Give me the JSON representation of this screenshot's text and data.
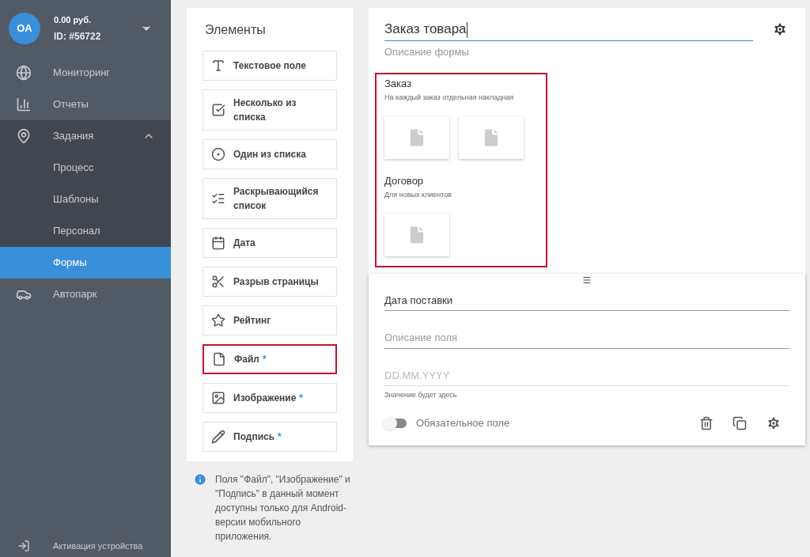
{
  "account": {
    "initials": "OA",
    "balance": "0.00 руб.",
    "id": "ID: #56722"
  },
  "nav": [
    {
      "kind": "globe",
      "label": "Мониторинг",
      "selected": false
    },
    {
      "kind": "chart",
      "label": "Отчеты",
      "selected": false
    },
    {
      "kind": "pin",
      "label": "Задания",
      "selected": false,
      "expanded": true,
      "children": [
        {
          "label": "Процесс",
          "selected": false
        },
        {
          "label": "Шаблоны",
          "selected": false
        },
        {
          "label": "Персонал",
          "selected": false
        },
        {
          "label": "Формы",
          "selected": true
        }
      ]
    },
    {
      "kind": "car",
      "label": "Автопарк",
      "selected": false
    }
  ],
  "activation": {
    "label": "Активация устройства"
  },
  "elements": {
    "title": "Элементы",
    "items": [
      {
        "kind": "text",
        "label": "Текстовое поле",
        "highlighted": false
      },
      {
        "kind": "checkbox",
        "label": "Несколько из списка",
        "highlighted": false
      },
      {
        "kind": "radio",
        "label": "Один из списка",
        "highlighted": false
      },
      {
        "kind": "dropdown",
        "label": "Раскрывающийся список",
        "highlighted": false
      },
      {
        "kind": "date",
        "label": "Дата",
        "highlighted": false
      },
      {
        "kind": "pagebreak",
        "label": "Разрыв страницы",
        "highlighted": false
      },
      {
        "kind": "rating",
        "label": "Рейтинг",
        "highlighted": false
      },
      {
        "kind": "file",
        "label": "Файл",
        "mark": "*",
        "highlighted": true
      },
      {
        "kind": "image",
        "label": "Изображение",
        "mark": "*",
        "highlighted": false
      },
      {
        "kind": "signature",
        "label": "Подпись",
        "mark": "*",
        "highlighted": false
      }
    ],
    "note": "Поля \"Файл\", \"Изображение\" и \"Подпись\" в данный момент доступны только для Android-версии мобильного приложения."
  },
  "form": {
    "title": "Заказ товара",
    "focused": true,
    "description_placeholder": "Описание формы",
    "highlighted": true,
    "sections": [
      {
        "title": "Заказ",
        "subtitle": "На каждый заказ отдельная накладная",
        "attachments": [
          {
            "kind": "file"
          },
          {
            "kind": "file"
          }
        ]
      },
      {
        "title": "Договор",
        "subtitle": "Для новых клиентов",
        "attachments": [
          {
            "kind": "file"
          }
        ]
      }
    ]
  },
  "field": {
    "label": "Дата поставки",
    "description_placeholder": "Описание поля",
    "date_placeholder": "DD.MM.YYYY",
    "hint": "Значение будет здесь",
    "required": {
      "label": "Обязательное поле",
      "on": false
    }
  }
}
